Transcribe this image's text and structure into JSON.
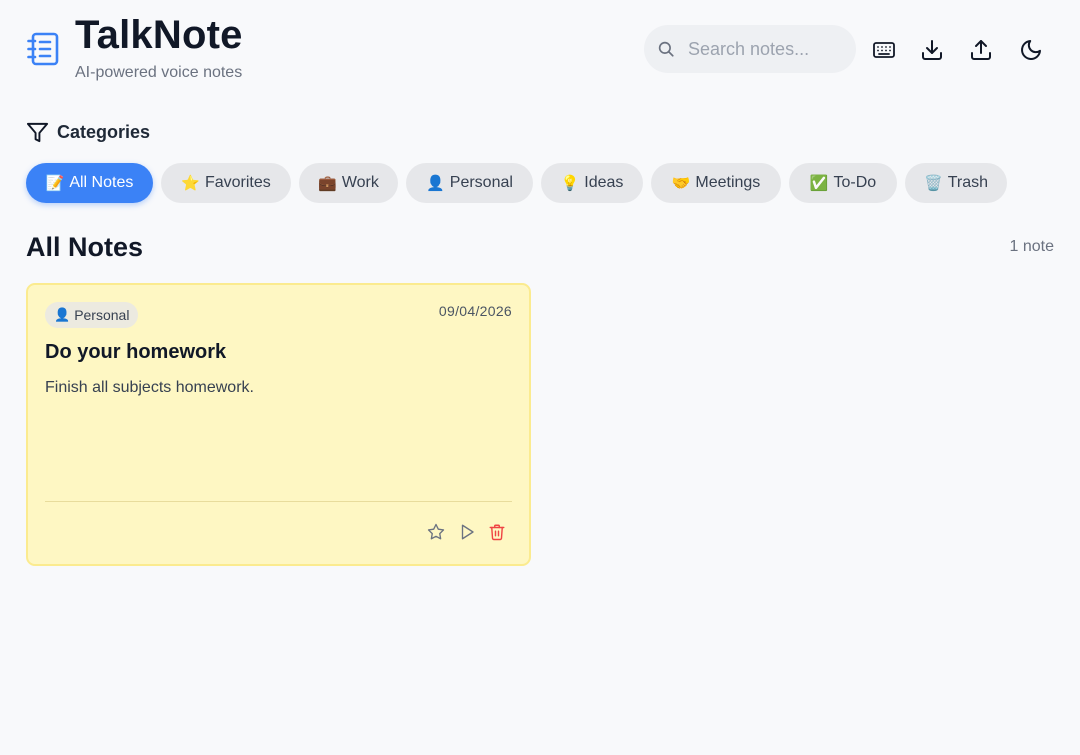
{
  "header": {
    "title": "TalkNote",
    "subtitle": "AI-powered voice notes",
    "search_placeholder": "Search notes...",
    "search_value": "",
    "toolbar_icons": [
      "keyboard-icon",
      "download-icon",
      "upload-icon",
      "moon-icon"
    ]
  },
  "categories": {
    "label": "Categories",
    "items": [
      {
        "emoji": "📝",
        "label": "All Notes",
        "active": true
      },
      {
        "emoji": "⭐",
        "label": "Favorites",
        "active": false
      },
      {
        "emoji": "💼",
        "label": "Work",
        "active": false
      },
      {
        "emoji": "👤",
        "label": "Personal",
        "active": false
      },
      {
        "emoji": "💡",
        "label": "Ideas",
        "active": false
      },
      {
        "emoji": "🤝",
        "label": "Meetings",
        "active": false
      },
      {
        "emoji": "✅",
        "label": "To-Do",
        "active": false
      },
      {
        "emoji": "🗑️",
        "label": "Trash",
        "active": false
      }
    ]
  },
  "main": {
    "section_title": "All Notes",
    "note_count": "1 note",
    "notes": [
      {
        "category_emoji": "👤",
        "category": "Personal",
        "date": "09/04/2026",
        "title": "Do your homework",
        "body": "Finish all subjects homework.",
        "actions": [
          "star-icon",
          "play-icon",
          "trash-icon"
        ]
      }
    ]
  },
  "colors": {
    "accent": "#3b82f6",
    "logo": "#3b82f6",
    "note_background": "#fef7c3",
    "danger": "#ef4444"
  }
}
